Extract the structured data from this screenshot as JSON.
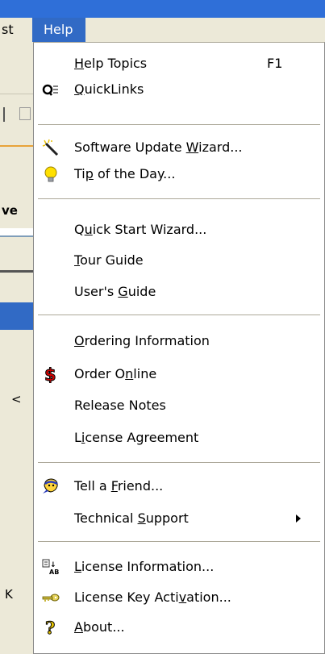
{
  "menubar": {
    "prev_item_label": "st",
    "help_label": "Help"
  },
  "background": {
    "texts": [
      "ve",
      "<",
      "K"
    ]
  },
  "menu": {
    "help_topics": {
      "pre": "",
      "u": "H",
      "post": "elp Topics",
      "shortcut": "F1"
    },
    "quicklinks": {
      "pre": "",
      "u": "Q",
      "post": "uickLinks"
    },
    "software_update": {
      "pre": "Software Update ",
      "u": "W",
      "post": "izard..."
    },
    "tip_of_day": {
      "pre": "Ti",
      "u": "p",
      "post": " of the Day..."
    },
    "quick_start": {
      "pre": "Q",
      "u": "u",
      "post": "ick Start Wizard..."
    },
    "tour_guide": {
      "pre": "",
      "u": "T",
      "post": "our Guide"
    },
    "users_guide": {
      "pre": "User's ",
      "u": "G",
      "post": "uide"
    },
    "ordering_info": {
      "pre": "",
      "u": "O",
      "post": "rdering Information"
    },
    "order_online": {
      "pre": "Order O",
      "u": "n",
      "post": "line"
    },
    "release_notes": {
      "pre": "Release Notes",
      "u": "",
      "post": ""
    },
    "license_agreement": {
      "pre": "L",
      "u": "i",
      "post": "cense Agreement"
    },
    "tell_friend": {
      "pre": "Tell a ",
      "u": "F",
      "post": "riend..."
    },
    "technical_support": {
      "pre": "Technical ",
      "u": "S",
      "post": "upport"
    },
    "license_info": {
      "pre": "",
      "u": "L",
      "post": "icense Information..."
    },
    "license_key": {
      "pre": "License Key Acti",
      "u": "v",
      "post": "ation..."
    },
    "about": {
      "pre": "",
      "u": "A",
      "post": "bout..."
    }
  },
  "colors": {
    "menu_highlight": "#316ac5",
    "title_blue": "#2f6fd8",
    "menu_bg": "#ffffff",
    "bg_gray": "#ece9d8"
  }
}
